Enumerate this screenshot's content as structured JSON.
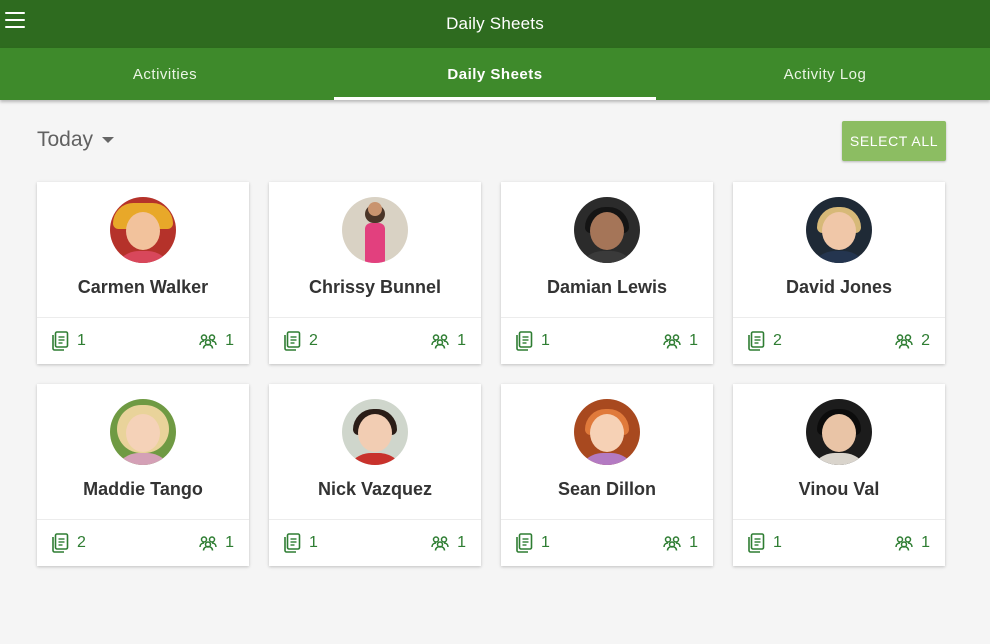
{
  "header": {
    "title": "Daily Sheets",
    "menu_icon": "hamburger-menu-icon"
  },
  "tabs": [
    {
      "label": "Activities",
      "active": false
    },
    {
      "label": "Daily Sheets",
      "active": true
    },
    {
      "label": "Activity Log",
      "active": false
    }
  ],
  "filter": {
    "date_value": "Today",
    "caret_icon": "caret-down-icon"
  },
  "actions": {
    "select_all_label": "SELECT ALL"
  },
  "colors": {
    "primary_dark": "#2e6b1f",
    "primary": "#3e8a2b",
    "accent": "#8cbd62",
    "icon_green": "#2e7d32"
  },
  "children": [
    {
      "name": "Carmen Walker",
      "sheets": "1",
      "groups": "1"
    },
    {
      "name": "Chrissy Bunnel",
      "sheets": "2",
      "groups": "1"
    },
    {
      "name": "Damian Lewis",
      "sheets": "1",
      "groups": "1"
    },
    {
      "name": "David Jones",
      "sheets": "2",
      "groups": "2"
    },
    {
      "name": "Maddie Tango",
      "sheets": "2",
      "groups": "1"
    },
    {
      "name": "Nick Vazquez",
      "sheets": "1",
      "groups": "1"
    },
    {
      "name": "Sean Dillon",
      "sheets": "1",
      "groups": "1"
    },
    {
      "name": "Vinou Val",
      "sheets": "1",
      "groups": "1"
    }
  ]
}
